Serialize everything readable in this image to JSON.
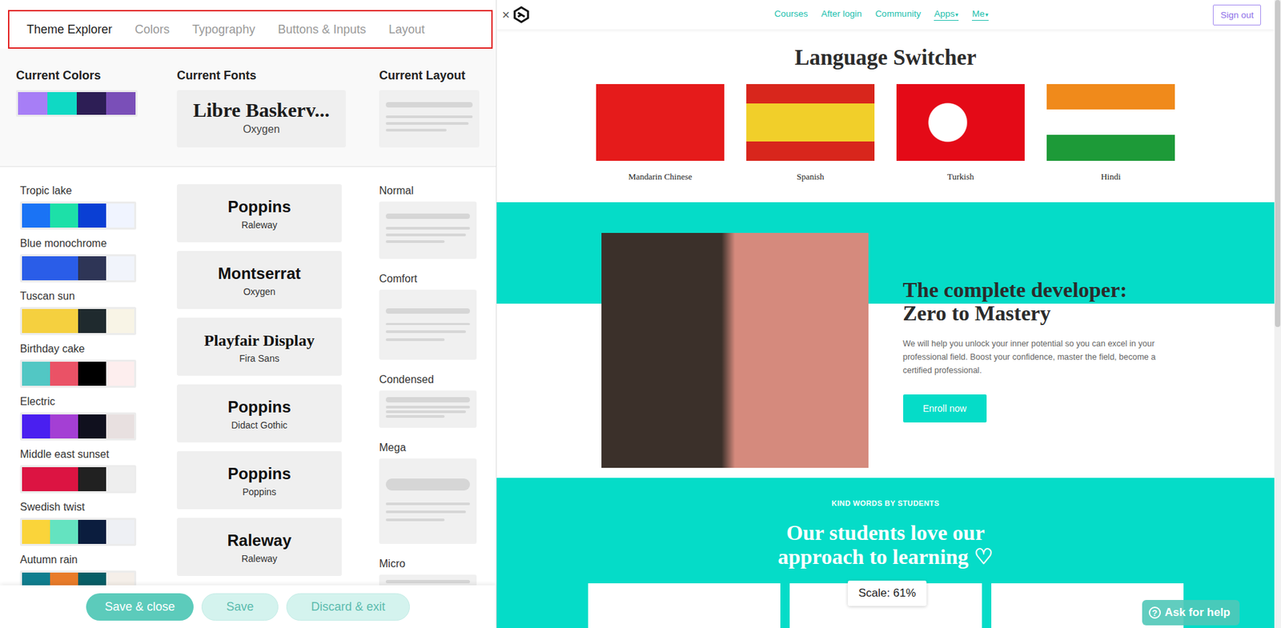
{
  "tabs": [
    {
      "label": "Theme Explorer",
      "selected": true
    },
    {
      "label": "Colors",
      "selected": false
    },
    {
      "label": "Typography",
      "selected": false
    },
    {
      "label": "Buttons & Inputs",
      "selected": false
    },
    {
      "label": "Layout",
      "selected": false
    }
  ],
  "current": {
    "colors_title": "Current Colors",
    "colors": [
      "#a77ef6",
      "#0fd9c4",
      "#2d1e55",
      "#7a4fb8"
    ],
    "fonts_title": "Current Fonts",
    "heading_font": "Libre Baskerv...",
    "body_font": "Oxygen",
    "layout_title": "Current Layout",
    "layout_kind": "normal"
  },
  "palettes": [
    {
      "name": "Tropic lake",
      "colors": [
        "#1a73f5",
        "#1de0a8",
        "#0a3fd4",
        "#f0f4ff"
      ]
    },
    {
      "name": "Blue monochrome",
      "colors": [
        "#2a5de8",
        "#2a5de8",
        "#2e3556",
        "#f1f4fb"
      ]
    },
    {
      "name": "Tuscan sun",
      "colors": [
        "#f5d03f",
        "#f5d03f",
        "#1f2a2e",
        "#f8f4e6"
      ]
    },
    {
      "name": "Birthday cake",
      "colors": [
        "#52c7c4",
        "#ea5266",
        "#000000",
        "#fdeeee"
      ]
    },
    {
      "name": "Electric",
      "colors": [
        "#4a1ff0",
        "#a43fd4",
        "#10101e",
        "#e8e0e0"
      ]
    },
    {
      "name": "Middle east sunset",
      "colors": [
        "#dc1442",
        "#dc1442",
        "#212121",
        "#eeeeee"
      ]
    },
    {
      "name": "Swedish twist",
      "colors": [
        "#fad43a",
        "#64e3c0",
        "#0b1d3e",
        "#eef0f4"
      ]
    },
    {
      "name": "Autumn rain",
      "colors": [
        "#0f7d8e",
        "#e87b29",
        "#085e66",
        "#f5efe9"
      ]
    }
  ],
  "font_pairs": [
    {
      "heading": "Poppins",
      "body": "Raleway",
      "kind": "sans"
    },
    {
      "heading": "Montserrat",
      "body": "Oxygen",
      "kind": "sans"
    },
    {
      "heading": "Playfair Display",
      "body": "Fira Sans",
      "kind": "serif"
    },
    {
      "heading": "Poppins",
      "body": "Didact Gothic",
      "kind": "sans"
    },
    {
      "heading": "Poppins",
      "body": "Poppins",
      "kind": "sans"
    },
    {
      "heading": "Raleway",
      "body": "Raleway",
      "kind": "sans"
    }
  ],
  "layouts": [
    {
      "name": "Normal",
      "kind": "normal"
    },
    {
      "name": "Comfort",
      "kind": "comfort"
    },
    {
      "name": "Condensed",
      "kind": "condensed"
    },
    {
      "name": "Mega",
      "kind": "mega"
    },
    {
      "name": "Micro",
      "kind": "micro"
    }
  ],
  "actions": [
    {
      "label": "Save & close",
      "kind": "primary"
    },
    {
      "label": "Save",
      "kind": "secondary"
    },
    {
      "label": "Discard & exit",
      "kind": "secondary"
    }
  ],
  "preview": {
    "close": "×",
    "nav": {
      "links": [
        {
          "label": "Courses",
          "caret": "",
          "active": false
        },
        {
          "label": "After login",
          "caret": "",
          "active": false
        },
        {
          "label": "Community",
          "caret": "",
          "active": false
        },
        {
          "label": "Apps",
          "caret": "▾",
          "active": true
        },
        {
          "label": "Me",
          "caret": "▾",
          "active": true
        }
      ],
      "sign_out": "Sign out"
    },
    "language_switcher": {
      "title": "Language Switcher",
      "languages": [
        "Mandarin Chinese",
        "Spanish",
        "Turkish",
        "Hindi"
      ]
    },
    "hero": {
      "title": "The complete developer: Zero to Mastery",
      "text": "We will help you unlock your inner potential so you can excel in your professional field. Boost your confidence, master the field, become a certified professional.",
      "button": "Enroll now"
    },
    "testimonials": {
      "kicker": "KIND WORDS BY STUDENTS",
      "title": "Our students love our approach to learning ♡"
    },
    "scale": "Scale: 61%",
    "help": {
      "icon": "?",
      "label": "Ask for help"
    }
  }
}
